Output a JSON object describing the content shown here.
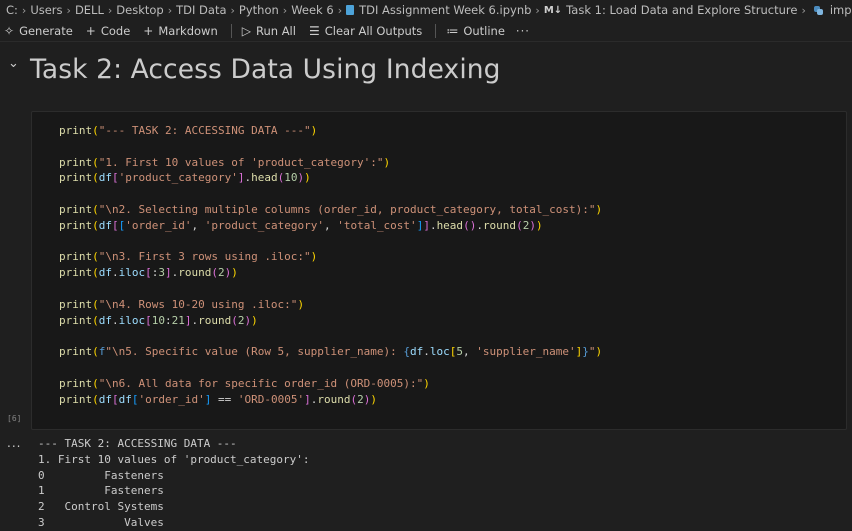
{
  "breadcrumb": [
    {
      "label": "C:",
      "icon": ""
    },
    {
      "label": "Users",
      "icon": ""
    },
    {
      "label": "DELL",
      "icon": ""
    },
    {
      "label": "Desktop",
      "icon": ""
    },
    {
      "label": "TDI Data",
      "icon": ""
    },
    {
      "label": "Python",
      "icon": ""
    },
    {
      "label": "Week 6",
      "icon": ""
    },
    {
      "label": "TDI Assignment Week 6.ipynb",
      "icon": "notebook-icon"
    },
    {
      "label": "Task 1: Load Data and Explore Structure",
      "icon": "markdown-icon"
    },
    {
      "label": "import pandas as pd",
      "icon": "python-icon"
    }
  ],
  "toolbar": {
    "generate": "Generate",
    "code": "Code",
    "markdown": "Markdown",
    "run_all": "Run All",
    "clear_all_outputs": "Clear All Outputs",
    "outline": "Outline",
    "more": "···"
  },
  "heading": "Task 2: Access Data Using Indexing",
  "cell": {
    "execution_count": "[6]",
    "lines": [
      "print(\"--- TASK 2: ACCESSING DATA ---\")",
      "",
      "print(\"1. First 10 values of 'product_category':\")",
      "print(df['product_category'].head(10))",
      "",
      "print(\"\\n2. Selecting multiple columns (order_id, product_category, total_cost):\")",
      "print(df[['order_id', 'product_category', 'total_cost']].head().round(2))",
      "",
      "print(\"\\n3. First 3 rows using .iloc:\")",
      "print(df.iloc[:3].round(2))",
      "",
      "print(\"\\n4. Rows 10-20 using .iloc:\")",
      "print(df.iloc[10:21].round(2))",
      "",
      "print(f\"\\n5. Specific value (Row 5, supplier_name): {df.loc[5, 'supplier_name']}\")",
      "",
      "print(\"\\n6. All data for specific order_id (ORD-0005):\")",
      "print(df[df['order_id'] == 'ORD-0005'].round(2))"
    ]
  },
  "output": {
    "dots": "...",
    "lines": [
      "--- TASK 2: ACCESSING DATA ---",
      "1. First 10 values of 'product_category':",
      "0         Fasteners",
      "1         Fasteners",
      "2   Control Systems",
      "3            Valves"
    ]
  },
  "colors": {
    "background": "#1f1f1f",
    "cell_background": "#181818",
    "function": "#dcdcaa",
    "string": "#ce9178",
    "number": "#b5cea8",
    "variable": "#9cdcfe"
  }
}
